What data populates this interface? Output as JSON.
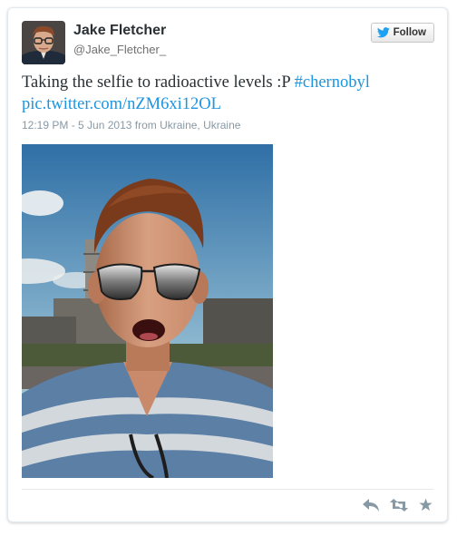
{
  "user": {
    "name": "Jake Fletcher",
    "handle": "@Jake_Fletcher_"
  },
  "follow_label": "Follow",
  "tweet": {
    "text": "Taking the selfie to radioactive levels :P",
    "hashtag": "#chernobyl",
    "link": "pic.twitter.com/nZM6xi12OL",
    "timestamp": "12:19 PM - 5 Jun 2013 from Ukraine, Ukraine"
  },
  "icons": {
    "follow": "twitter-bird-icon",
    "reply": "reply-icon",
    "retweet": "retweet-icon",
    "favorite": "star-icon"
  },
  "colors": {
    "link": "#1b95e0",
    "name": "#292f33",
    "muted": "#8899a6",
    "action_icon": "#8899a6"
  }
}
